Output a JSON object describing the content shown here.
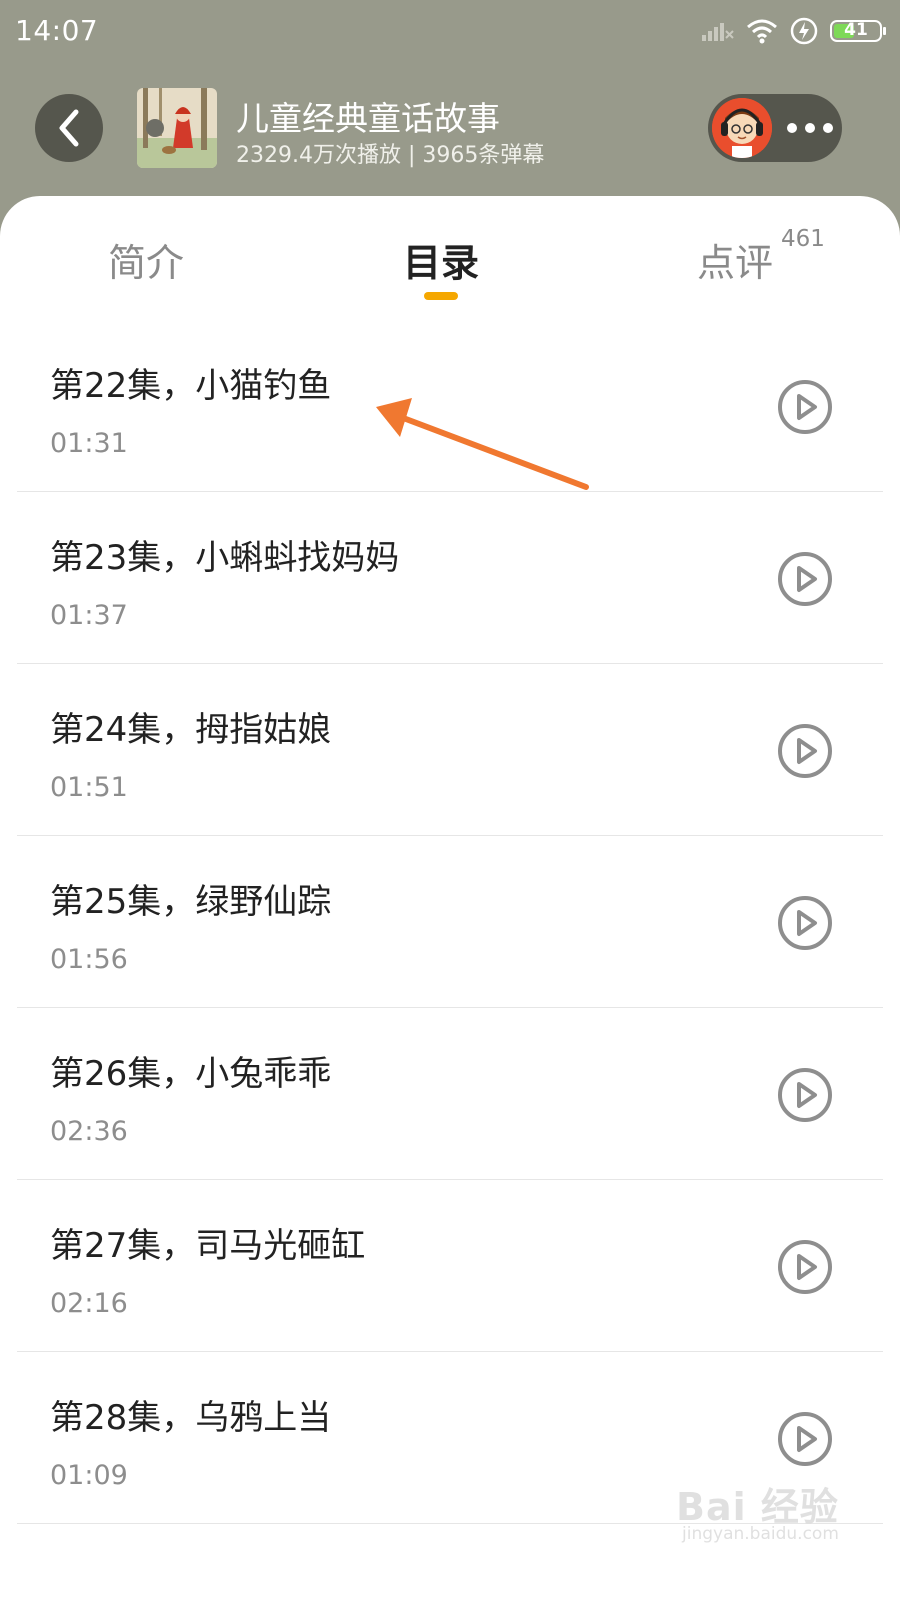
{
  "status_bar": {
    "time": "14:07",
    "battery_level": "41",
    "icons": [
      "signal-icon",
      "wifi-icon",
      "charging-icon",
      "battery-icon"
    ]
  },
  "header": {
    "title": "儿童经典童话故事",
    "stats": "2329.4万次播放 | 3965条弹幕",
    "back_icon": "back-chevron-icon",
    "more_icon": "more-dots-icon"
  },
  "tabs": [
    {
      "label": "简介",
      "active": false
    },
    {
      "label": "目录",
      "active": true
    },
    {
      "label": "点评",
      "active": false,
      "badge": "461"
    }
  ],
  "episodes": [
    {
      "title": "第22集，小猫钓鱼",
      "duration": "01:31"
    },
    {
      "title": "第23集，小蝌蚪找妈妈",
      "duration": "01:37"
    },
    {
      "title": "第24集，拇指姑娘",
      "duration": "01:51"
    },
    {
      "title": "第25集，绿野仙踪",
      "duration": "01:56"
    },
    {
      "title": "第26集，小兔乖乖",
      "duration": "02:36"
    },
    {
      "title": "第27集，司马光砸缸",
      "duration": "02:16"
    },
    {
      "title": "第28集，乌鸦上当",
      "duration": "01:09"
    }
  ],
  "watermark": {
    "main": "Bai 经验",
    "sub": "jingyan.baidu.com"
  },
  "colors": {
    "header_bg": "#989a8b",
    "accent": "#f5a700",
    "annotation_arrow": "#f07830"
  }
}
